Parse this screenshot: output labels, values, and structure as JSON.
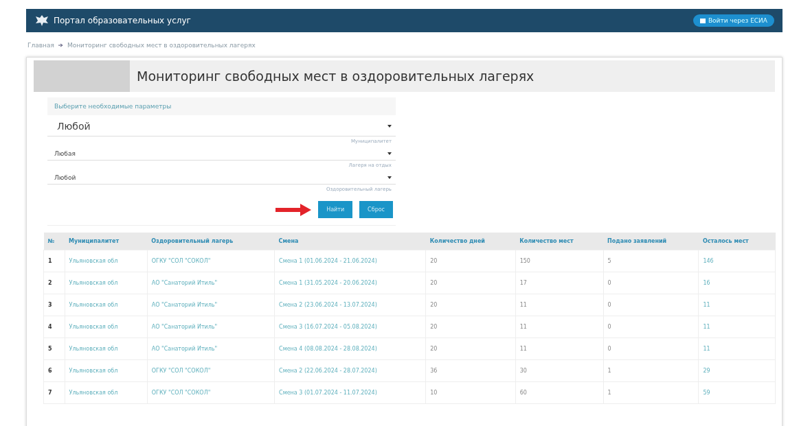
{
  "header": {
    "title": "Портал образовательных услуг",
    "login_button": "Войти через ЕСИА"
  },
  "breadcrumb": [
    "Главная",
    "Мониторинг свободных мест в оздоровительных лагерях"
  ],
  "page_title": "Мониторинг свободных мест в оздоровительных лагерях",
  "filters": {
    "heading": "Выберите необходимые параметры",
    "fields": [
      {
        "value": "Любой",
        "label": "Муниципалитет",
        "kind": "large"
      },
      {
        "value": "Любая",
        "label": "Лагеря на отдых",
        "kind": "normal"
      },
      {
        "value": "Любой",
        "label": "Оздоровительный лагерь",
        "kind": "normal"
      }
    ],
    "buttons": [
      "Найти",
      "Сброс"
    ]
  },
  "table": {
    "columns": [
      "№",
      "Муниципалитет",
      "Оздоровительный лагерь",
      "Смена",
      "Количество дней",
      "Количество мест",
      "Подано заявлений",
      "Осталось мест"
    ],
    "rows": [
      [
        "1",
        "Ульяновская обл",
        "ОГКУ \"СОЛ \"СОКОЛ\"",
        "Смена 1 (01.06.2024 - 21.06.2024)",
        "20",
        "150",
        "5",
        "146"
      ],
      [
        "2",
        "Ульяновская обл",
        "АО \"Санаторий Итиль\"",
        "Смена 1 (31.05.2024 - 20.06.2024)",
        "20",
        "17",
        "0",
        "16"
      ],
      [
        "3",
        "Ульяновская обл",
        "АО \"Санаторий Итиль\"",
        "Смена 2 (23.06.2024 - 13.07.2024)",
        "20",
        "11",
        "0",
        "11"
      ],
      [
        "4",
        "Ульяновская обл",
        "АО \"Санаторий Итиль\"",
        "Смена 3 (16.07.2024 - 05.08.2024)",
        "20",
        "11",
        "0",
        "11"
      ],
      [
        "5",
        "Ульяновская обл",
        "АО \"Санаторий Итиль\"",
        "Смена 4 (08.08.2024 - 28.08.2024)",
        "20",
        "11",
        "0",
        "11"
      ],
      [
        "6",
        "Ульяновская обл",
        "ОГКУ \"СОЛ \"СОКОЛ\"",
        "Смена 2 (22.06.2024 - 28.07.2024)",
        "36",
        "30",
        "1",
        "29"
      ],
      [
        "7",
        "Ульяновская обл",
        "ОГКУ \"СОЛ \"СОКОЛ\"",
        "Смена 3 (01.07.2024 - 11.07.2024)",
        "10",
        "60",
        "1",
        "59"
      ]
    ]
  }
}
